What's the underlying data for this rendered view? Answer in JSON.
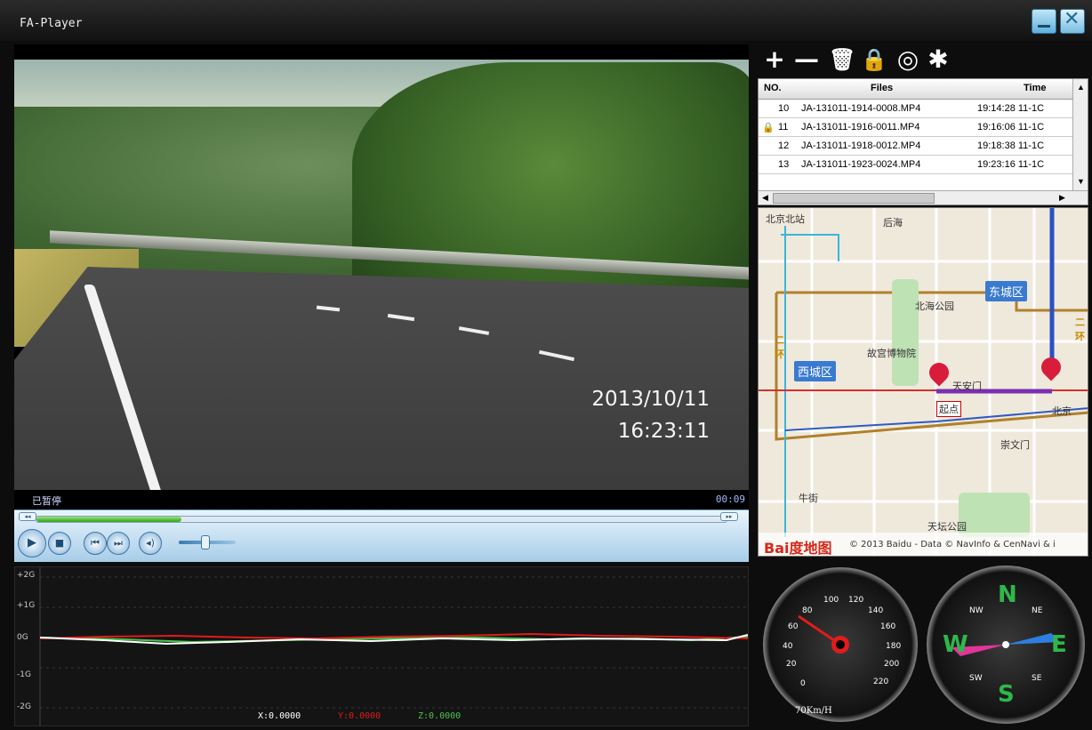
{
  "window": {
    "title": "FA-Player"
  },
  "video": {
    "osd_date": "2013/10/11",
    "osd_time": "16:23:11"
  },
  "player": {
    "status": "已暂停",
    "elapsed": "00:09",
    "progress_percent": 21
  },
  "accelerometer": {
    "axis_labels": [
      "+2G",
      "+1G",
      "0G",
      "-1G",
      "-2G"
    ],
    "x_label": "X:0.0000",
    "y_label": "Y:0.0000",
    "z_label": "Z:0.0000",
    "colors": {
      "x": "#ffffff",
      "y": "#e01b1b",
      "z": "#4cc24c"
    }
  },
  "filelist": {
    "headers": {
      "no": "NO.",
      "files": "Files",
      "time": "Time"
    },
    "rows": [
      {
        "no": "10",
        "file": "JA-131011-1914-0008.MP4",
        "time": "19:14:28 11-1C",
        "locked": false
      },
      {
        "no": "11",
        "file": "JA-131011-1916-0011.MP4",
        "time": "19:16:06 11-1C",
        "locked": true
      },
      {
        "no": "12",
        "file": "JA-131011-1918-0012.MP4",
        "time": "19:18:38 11-1C",
        "locked": false
      },
      {
        "no": "13",
        "file": "JA-131011-1923-0024.MP4",
        "time": "19:23:16 11-1C",
        "locked": false
      }
    ]
  },
  "toolbar": {
    "icons": [
      "add-icon",
      "remove-icon",
      "delete-icon",
      "lock-icon",
      "globe-icon",
      "settings-icon"
    ],
    "add": "+",
    "remove": "—",
    "delete": "🗑",
    "lock": "🔒",
    "globe": "◎",
    "settings": "✱"
  },
  "map": {
    "labels": {
      "beijing_north": "北京北站",
      "houhai": "后海",
      "dongcheng": "东城区",
      "beihai": "北海公园",
      "palace": "故宫博物院",
      "xicheng": "西城区",
      "tiananmen": "天安门",
      "start": "起点",
      "beijing_station": "北京",
      "chongwenmen": "崇文门",
      "niujie": "牛街",
      "temple": "天坛公园",
      "ring_left": "二环",
      "ring_right": "二环"
    },
    "brand": "Bai度地图",
    "copyright": "© 2013 Baidu - Data © NavInfo & CenNavi & i"
  },
  "speedometer": {
    "ticks": [
      "20",
      "40",
      "60",
      "80",
      "100",
      "120",
      "140",
      "160",
      "180",
      "200",
      "220",
      "0"
    ],
    "reading": "70Km/H"
  },
  "compass": {
    "n": "N",
    "s": "S",
    "e": "E",
    "w": "W",
    "ne": "NE",
    "nw": "NW",
    "se": "SE",
    "sw": "SW"
  }
}
